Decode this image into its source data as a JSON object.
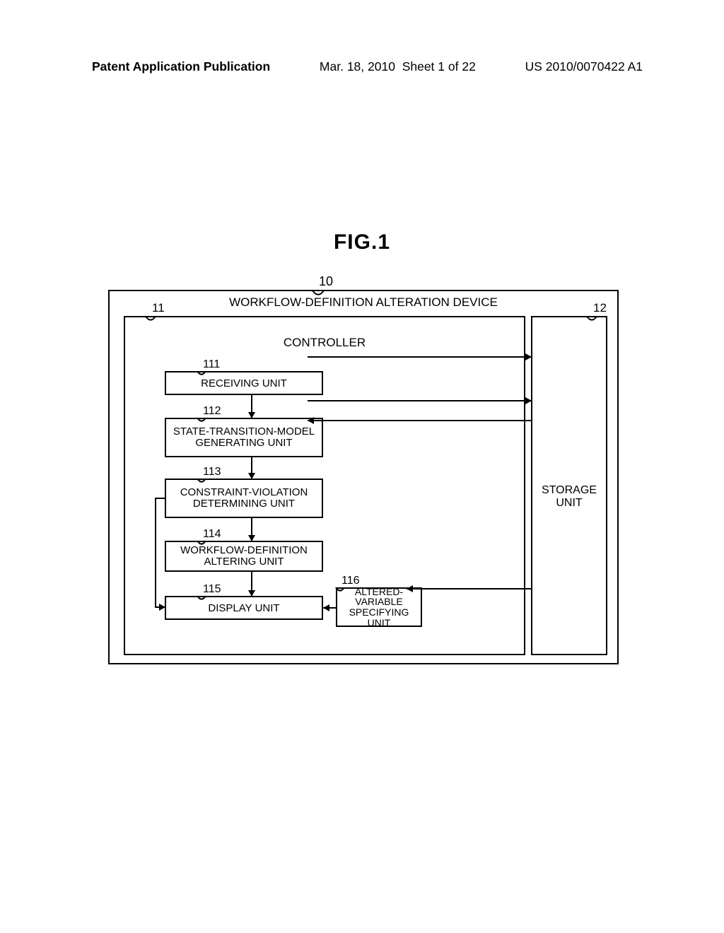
{
  "header": {
    "left": "Patent Application Publication",
    "date": "Mar. 18, 2010",
    "sheet": "Sheet 1 of 22",
    "right": "US 2010/0070422 A1"
  },
  "figure_title": "FIG.1",
  "device": {
    "ref": "10",
    "label": "WORKFLOW-DEFINITION ALTERATION DEVICE"
  },
  "controller": {
    "ref": "11",
    "label": "CONTROLLER"
  },
  "storage": {
    "ref": "12",
    "label_line1": "STORAGE",
    "label_line2": "UNIT"
  },
  "units": {
    "u111": {
      "ref": "111",
      "label": "RECEIVING UNIT"
    },
    "u112": {
      "ref": "112",
      "label": "STATE-TRANSITION-MODEL GENERATING UNIT"
    },
    "u113": {
      "ref": "113",
      "label": "CONSTRAINT-VIOLATION DETERMINING UNIT"
    },
    "u114": {
      "ref": "114",
      "label": "WORKFLOW-DEFINITION ALTERING UNIT"
    },
    "u115": {
      "ref": "115",
      "label": "DISPLAY UNIT"
    },
    "u116": {
      "ref": "116",
      "label": "ALTERED-VARIABLE SPECIFYING UNIT"
    }
  }
}
